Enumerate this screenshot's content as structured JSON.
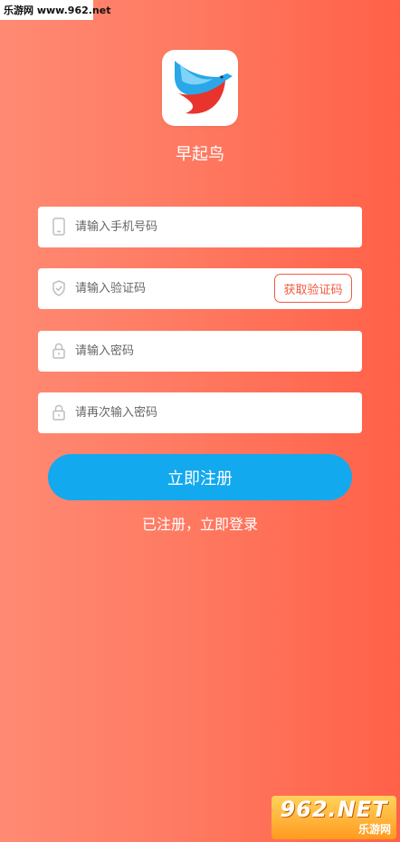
{
  "watermark_top": "乐游网 www.962.net",
  "app_name": "早起鸟",
  "phone": {
    "placeholder": "请输入手机号码",
    "icon": "phone-icon"
  },
  "code": {
    "placeholder": "请输入验证码",
    "icon": "shield-check-icon",
    "button_label": "获取验证码"
  },
  "password": {
    "placeholder": "请输入密码",
    "icon": "lock-icon"
  },
  "password_confirm": {
    "placeholder": "请再次输入密码",
    "icon": "lock-icon"
  },
  "register_button": "立即注册",
  "login_link": "已注册，立即登录",
  "watermark_bottom": {
    "big": "962.NET",
    "small": "乐游网"
  },
  "colors": {
    "background_left": "#ff8a73",
    "background_right": "#ff6148",
    "accent_red": "#f25a42",
    "register_blue": "#12a9ee"
  }
}
